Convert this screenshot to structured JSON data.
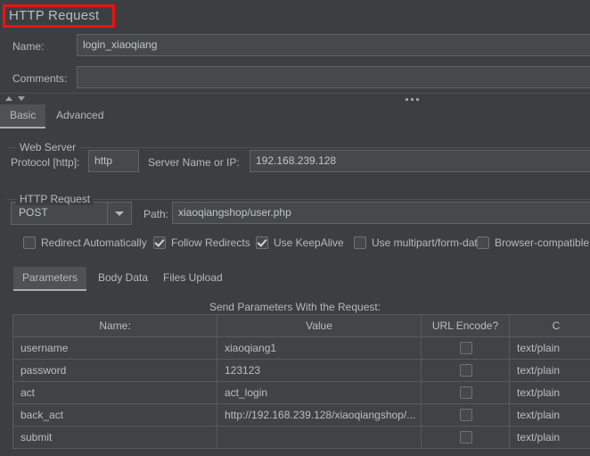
{
  "window": {
    "title": "HTTP Request",
    "highlight_color": "#ee1111"
  },
  "header_fields": [
    {
      "label": "Name:",
      "value": "login_xiaoqiang"
    },
    {
      "label": "Comments:",
      "value": ""
    }
  ],
  "main_tabs": [
    {
      "label": "Basic",
      "selected": true
    },
    {
      "label": "Advanced",
      "selected": false
    }
  ],
  "web_server": {
    "group_title": "Web Server",
    "protocol_label": "Protocol [http]:",
    "protocol_value": "http",
    "server_label": "Server Name or IP:",
    "server_value": "192.168.239.128"
  },
  "http_request": {
    "group_title": "HTTP Request",
    "method": "POST",
    "path_label": "Path:",
    "path_value": "xiaoqiangshop/user.php",
    "options": [
      {
        "label": "Redirect Automatically",
        "checked": false
      },
      {
        "label": "Follow Redirects",
        "checked": true
      },
      {
        "label": "Use KeepAlive",
        "checked": true
      },
      {
        "label": "Use multipart/form-data",
        "checked": false
      },
      {
        "label": "Browser-compatible he",
        "checked": false
      }
    ]
  },
  "inner_tabs": [
    {
      "label": "Parameters",
      "selected": true
    },
    {
      "label": "Body Data",
      "selected": false
    },
    {
      "label": "Files Upload",
      "selected": false
    }
  ],
  "parameters_table": {
    "caption": "Send Parameters With the Request:",
    "columns": [
      "Name:",
      "Value",
      "URL Encode?",
      "C"
    ],
    "rows": [
      {
        "name": "username",
        "value": "xiaoqiang1",
        "url_encode": false,
        "content_type": "text/plain"
      },
      {
        "name": "password",
        "value": "123123",
        "url_encode": false,
        "content_type": "text/plain"
      },
      {
        "name": "act",
        "value": "act_login",
        "url_encode": false,
        "content_type": "text/plain"
      },
      {
        "name": "back_act",
        "value": "http://192.168.239.128/xiaoqiangshop/...",
        "url_encode": false,
        "content_type": "text/plain"
      },
      {
        "name": "submit",
        "value": "",
        "url_encode": false,
        "content_type": "text/plain"
      }
    ]
  }
}
